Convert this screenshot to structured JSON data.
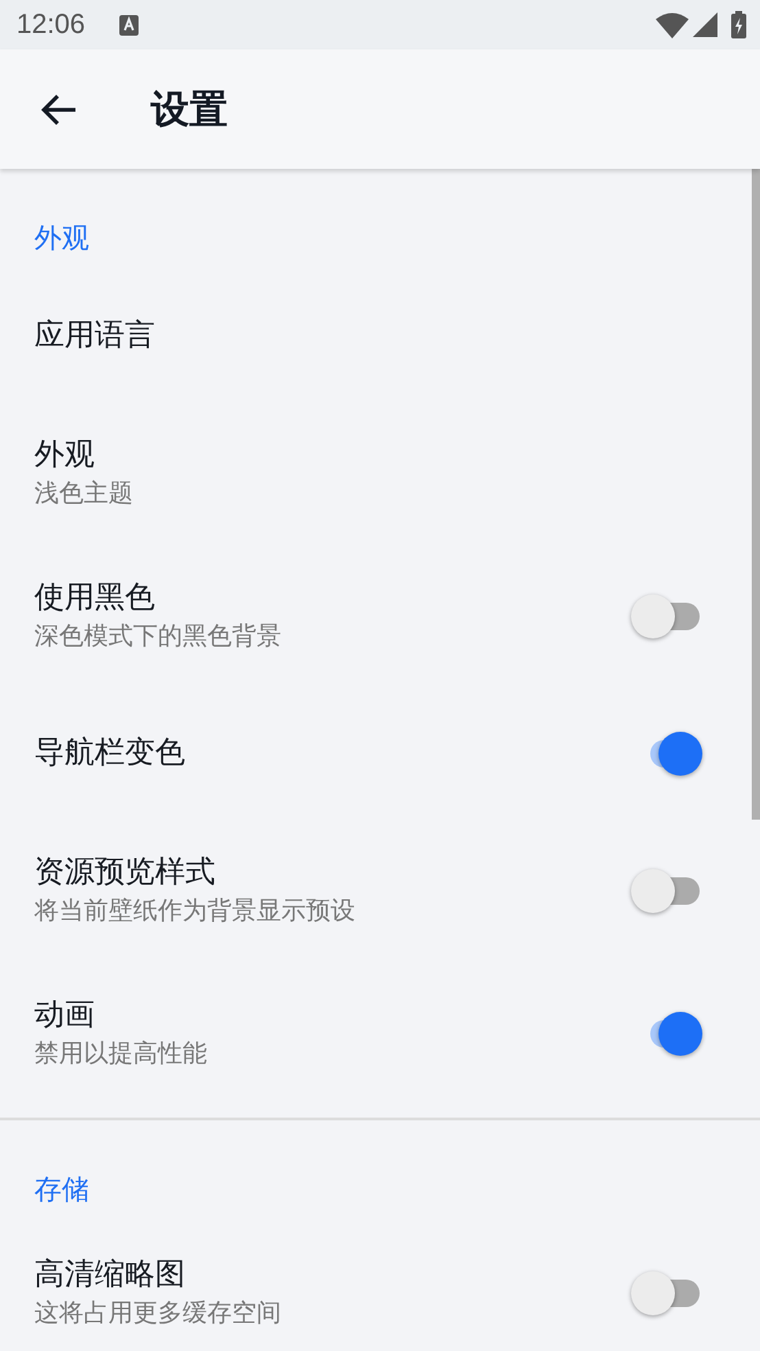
{
  "status_bar": {
    "time": "12:06"
  },
  "app_bar": {
    "title": "设置"
  },
  "sections": [
    {
      "header": "外观",
      "items": [
        {
          "kind": "plain",
          "title": "应用语言"
        },
        {
          "kind": "plain",
          "title": "外观",
          "summary": "浅色主题"
        },
        {
          "kind": "toggle",
          "title": "使用黑色",
          "summary": "深色模式下的黑色背景",
          "on": false
        },
        {
          "kind": "toggle",
          "title": "导航栏变色",
          "on": true
        },
        {
          "kind": "toggle",
          "title": "资源预览样式",
          "summary": "将当前壁纸作为背景显示预设",
          "on": false
        },
        {
          "kind": "toggle",
          "title": "动画",
          "summary": "禁用以提高性能",
          "on": true
        }
      ]
    },
    {
      "header": "存储",
      "items": [
        {
          "kind": "toggle",
          "title": "高清缩略图",
          "summary": "这将占用更多缓存空间",
          "on": false
        }
      ]
    }
  ]
}
